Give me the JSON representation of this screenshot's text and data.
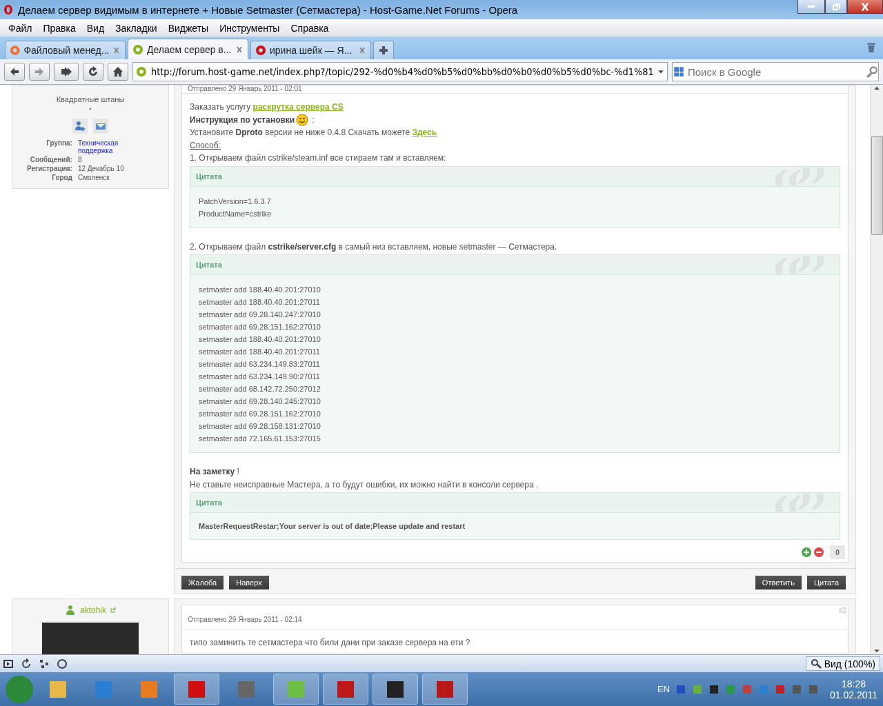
{
  "window": {
    "title": "Делаем сервер видимым в интернете + Новые Setmaster (Сетмастера) - Host-Game.Net Forums - Opera"
  },
  "menu": [
    "Файл",
    "Правка",
    "Вид",
    "Закладки",
    "Виджеты",
    "Инструменты",
    "Справка"
  ],
  "tabs": [
    {
      "label": "Файловый менед...",
      "selected": false
    },
    {
      "label": "Делаем сервер в...",
      "selected": true
    },
    {
      "label": "ирина шейк — Я...",
      "selected": false
    }
  ],
  "address": {
    "value": "http://forum.host-game.net/index.php?/topic/292-%d0%b4%d0%b5%d0%bb%d0%b0%d0%b5%d0%bc-%d1%81"
  },
  "search": {
    "placeholder": "Поиск в Google"
  },
  "posts": [
    {
      "author": {
        "title": "Квадратные штаны",
        "dot": "·",
        "fields": [
          {
            "label": "Группа:",
            "value": "Техническая поддержка",
            "link": true
          },
          {
            "label": "Сообщений:",
            "value": "8",
            "link": false
          },
          {
            "label": "Регистрация:",
            "value": "12 Декабрь 10",
            "link": false
          },
          {
            "label": "Город",
            "value": "Смоленск",
            "link": false
          }
        ]
      },
      "posted": "Отправлено 29 Январь 2011 - 02:01",
      "body": [
        {
          "kind": "line",
          "text": "Заказать услугу ",
          "link": "раскрутка сервера CS"
        },
        {
          "kind": "line",
          "text": "**Инструкция по установки**",
          "smiley": true,
          "tail": " :"
        },
        {
          "kind": "line",
          "text": "Установите **Dproto** версии не ниже 0.4.8 Скачать можете ",
          "link": "Здесь"
        },
        {
          "kind": "line",
          "text": "Способ:",
          "underlined": true
        },
        {
          "kind": "line",
          "text": "1. Открываем файл cstrike/steam.inf все стираем там и вставляем:"
        },
        {
          "kind": "quote",
          "label": "Цитата",
          "bold": false,
          "lines": [
            "PatchVersion=1.6.3.7",
            "ProductName=cstrike"
          ]
        },
        {
          "kind": "line",
          "text": "2. Открываем файл **cstrike/server.cfg** в самый низ вставляем, новые setmaster — Сетмастера."
        },
        {
          "kind": "quote",
          "label": "Цитата",
          "bold": false,
          "lines": [
            "setmaster add 188.40.40.201:27010",
            "setmaster add 188.40.40.201:27011",
            "setmaster add 69.28.140.247:27010",
            "setmaster add 69.28.151.162:27010",
            "setmaster add 188.40.40.201:27010",
            "setmaster add 188.40.40.201:27011",
            "setmaster add 63.234.149.83:27011",
            "setmaster add 63.234.149.90:27011",
            "setmaster add 68.142.72.250:27012",
            "setmaster add 69.28.140.245:27010",
            "setmaster add 69.28.151.162:27010",
            "setmaster add 69.28.158.131:27010",
            "setmaster add 72.165.61.153:27015"
          ]
        },
        {
          "kind": "line",
          "text": "**На заметку** !"
        },
        {
          "kind": "line",
          "text": "Не ставьте неисправные Мастера, а то будут ошибки, их можно найти в консоли сервера ."
        },
        {
          "kind": "quote",
          "label": "Цитата",
          "bold": true,
          "lines": [
            "MasterRequestRestar;Your server is out of date;Please update and restart"
          ]
        }
      ],
      "rating": "0",
      "actions_left": [
        "Жалоба",
        "Наверх"
      ],
      "actions_right": [
        "Ответить",
        "Цитата"
      ]
    },
    {
      "author": {
        "name": "aktohik",
        "photo": true
      },
      "number": "#2",
      "posted": "Отправлено 29 Январь 2011 - 02:14",
      "text": "типо заминить те сетмастера что били дани при заказе сервера на ети ?"
    }
  ],
  "status_bar": {
    "zoom": "Вид (100%)"
  },
  "taskbar": {
    "apps": [
      {
        "running": false
      },
      {
        "running": false
      },
      {
        "running": false
      },
      {
        "running": true
      },
      {
        "running": false
      },
      {
        "running": true
      },
      {
        "running": true
      },
      {
        "running": true
      },
      {
        "running": true
      }
    ],
    "language": "EN",
    "time": "18:28",
    "date": "01.02.2011"
  }
}
